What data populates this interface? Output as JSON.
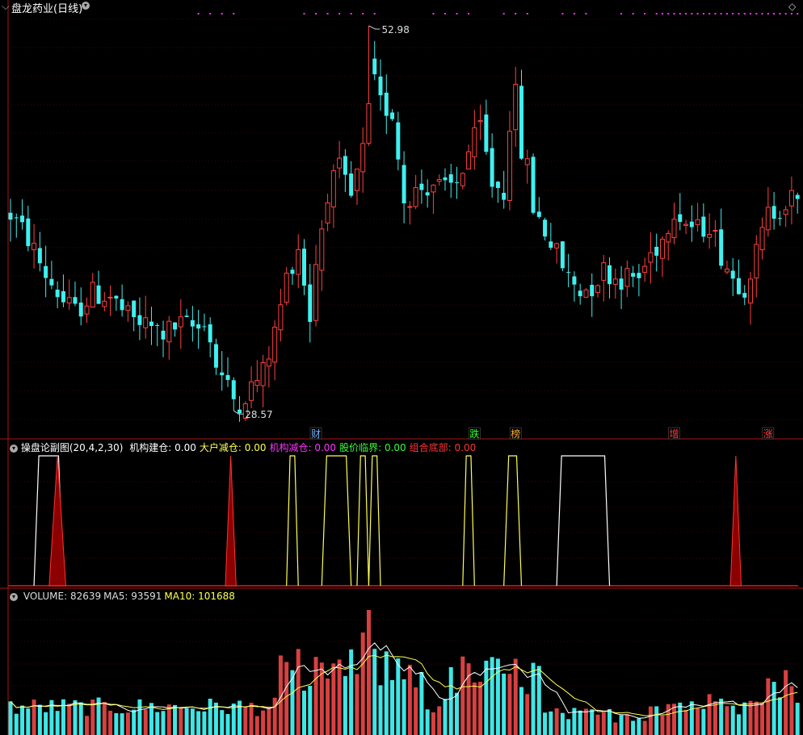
{
  "app": {
    "title": "盘龙药业(日线)",
    "colors": {
      "up": "#ff4040",
      "down": "#3ff0f0",
      "grid": "#8b0000",
      "panel_border": "#aa1515",
      "white": "#ffffff",
      "yellow": "#ffff55",
      "magenta": "#ff33ff",
      "green": "#33ff33",
      "red": "#ff3333"
    }
  },
  "main": {
    "high_label": "52.98",
    "low_label": "28.57",
    "event_markers": [
      {
        "text": "财",
        "bar": 52,
        "color": "#6fb0ff"
      },
      {
        "text": "跌",
        "bar": 79,
        "color": "#33ff33"
      },
      {
        "text": "榜",
        "bar": 86,
        "color": "#ffaa33"
      },
      {
        "text": "增",
        "bar": 113,
        "color": "#ff4040"
      },
      {
        "text": "涨",
        "bar": 129,
        "color": "#ff4040"
      }
    ]
  },
  "indicator": {
    "name": "操盘论副图",
    "params": "(20,4,2,30)",
    "items": [
      {
        "label": "机构建仓:",
        "value": "0.00",
        "color": "#ffffff"
      },
      {
        "label": "大户减仓:",
        "value": "0.00",
        "color": "#ffff55"
      },
      {
        "label": "机构减仓:",
        "value": "0.00",
        "color": "#ff33ff"
      },
      {
        "label": "股价临界:",
        "value": "0.00",
        "color": "#33ff33"
      },
      {
        "label": "组合底部:",
        "value": "0.00",
        "color": "#ff3333"
      }
    ]
  },
  "volume_panel": {
    "items": [
      {
        "label": "VOLUME:",
        "value": "82639",
        "color": "#dddddd"
      },
      {
        "label": "MA5:",
        "value": "93591",
        "color": "#dddddd"
      },
      {
        "label": "MA10:",
        "value": "101688",
        "color": "#ffff55"
      }
    ]
  },
  "chart_data": [
    {
      "type": "candlestick",
      "title": "盘龙药业(日线)",
      "ylim": [
        27.5,
        54.0
      ],
      "n_bars": 135,
      "anchors": [
        [
          0,
          41.0
        ],
        [
          3,
          39.5
        ],
        [
          6,
          37.2
        ],
        [
          9,
          35.5
        ],
        [
          11,
          34.8
        ],
        [
          14,
          36.0
        ],
        [
          17,
          35.8
        ],
        [
          20,
          34.5
        ],
        [
          23,
          34.0
        ],
        [
          26,
          33.5
        ],
        [
          29,
          34.0
        ],
        [
          32,
          33.8
        ],
        [
          33,
          34.5
        ],
        [
          35,
          31.5
        ],
        [
          37,
          30.0
        ],
        [
          38,
          28.8
        ],
        [
          40,
          29.6
        ],
        [
          43,
          31.0
        ],
        [
          45,
          33.5
        ],
        [
          47,
          37.0
        ],
        [
          49,
          39.0
        ],
        [
          51,
          34.5
        ],
        [
          52,
          38.0
        ],
        [
          54,
          42.5
        ],
        [
          56,
          43.8
        ],
        [
          58,
          42.0
        ],
        [
          60,
          45.0
        ],
        [
          61,
          50.5
        ],
        [
          63,
          48.0
        ],
        [
          65,
          47.5
        ],
        [
          67,
          42.0
        ],
        [
          69,
          42.5
        ],
        [
          72,
          43.0
        ],
        [
          74,
          42.5
        ],
        [
          76,
          43.0
        ],
        [
          78,
          45.0
        ],
        [
          80,
          46.5
        ],
        [
          82,
          43.0
        ],
        [
          84,
          42.5
        ],
        [
          85,
          47.0
        ],
        [
          86,
          48.5
        ],
        [
          87,
          45.0
        ],
        [
          88,
          44.0
        ],
        [
          89,
          41.5
        ],
        [
          91,
          40.0
        ],
        [
          93,
          38.5
        ],
        [
          95,
          37.0
        ],
        [
          97,
          36.2
        ],
        [
          99,
          36.5
        ],
        [
          101,
          37.5
        ],
        [
          103,
          37.0
        ],
        [
          105,
          37.0
        ],
        [
          107,
          37.0
        ],
        [
          109,
          38.5
        ],
        [
          111,
          39.5
        ],
        [
          113,
          41.5
        ],
        [
          115,
          40.5
        ],
        [
          117,
          40.0
        ],
        [
          119,
          40.5
        ],
        [
          121,
          38.5
        ],
        [
          123,
          37.0
        ],
        [
          125,
          36.5
        ],
        [
          127,
          38.5
        ],
        [
          129,
          41.0
        ],
        [
          131,
          41.5
        ],
        [
          133,
          42.0
        ],
        [
          134,
          41.5
        ]
      ],
      "high": 52.98,
      "low": 28.57
    },
    {
      "type": "line",
      "title": "操盘论副图",
      "series": [
        {
          "name": "机构建仓",
          "pulses": [
            [
              4,
              9
            ],
            [
              93,
              102
            ]
          ]
        },
        {
          "name": "大户减仓",
          "pulses": [
            [
              47,
              49
            ],
            [
              53,
              58
            ],
            [
              59,
              61
            ],
            [
              61,
              63
            ],
            [
              77,
              79
            ],
            [
              84,
              87
            ]
          ]
        },
        {
          "name": "组合底部",
          "pulses": [
            [
              7,
              9
            ],
            [
              37,
              38
            ],
            [
              123,
              124
            ]
          ]
        }
      ]
    },
    {
      "type": "bar",
      "title": "VOLUME",
      "series": [
        {
          "name": "VOLUME",
          "last": 82639
        },
        {
          "name": "MA5",
          "last": 93591
        },
        {
          "name": "MA10",
          "last": 101688
        }
      ]
    }
  ]
}
